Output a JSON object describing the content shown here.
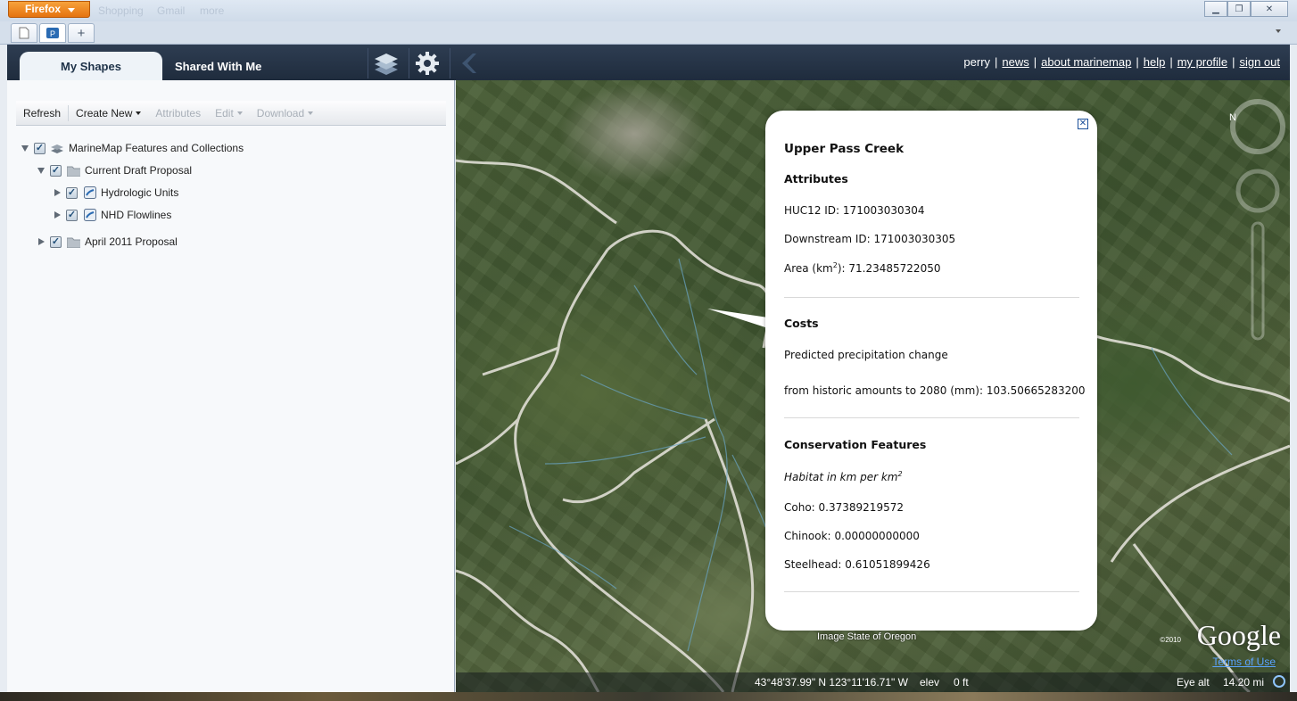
{
  "browser": {
    "app_button": "Firefox",
    "bookmarks": [
      "Shopping",
      "Gmail",
      "more"
    ],
    "new_tab_glyph": "+"
  },
  "header": {
    "tabs": [
      {
        "label": "My Shapes"
      },
      {
        "label": "Shared With Me"
      }
    ],
    "links": {
      "user": "perry",
      "news": "news",
      "about": "about marinemap",
      "help": "help",
      "profile": "my profile",
      "signout": "sign out"
    }
  },
  "toolbar": {
    "refresh": "Refresh",
    "create_new": "Create New",
    "attributes": "Attributes",
    "edit": "Edit",
    "download": "Download"
  },
  "tree": {
    "root": "MarineMap Features and Collections",
    "draft": "Current Draft Proposal",
    "hydro": "Hydrologic Units",
    "nhd": "NHD Flowlines",
    "april": "April 2011 Proposal"
  },
  "balloon": {
    "title": "Upper Pass Creek",
    "attributes_heading": "Attributes",
    "huc12_label": "HUC12 ID:",
    "huc12_value": "171003030304",
    "downstream_label": "Downstream ID:",
    "downstream_value": "171003030305",
    "area_label": "Area (km",
    "area_sup": "2",
    "area_suffix": "):",
    "area_value": "71.23485722050",
    "costs_heading": "Costs",
    "precip_line1": "Predicted precipitation change",
    "precip_line2_label": "from historic amounts to 2080 (mm):",
    "precip_value": "103.50665283200",
    "conservation_heading": "Conservation Features",
    "habitat_label": "Habitat in km per km",
    "habitat_sup": "2",
    "coho_label": "Coho:",
    "coho_value": "0.37389219572",
    "chinook_label": "Chinook:",
    "chinook_value": "0.00000000000",
    "steelhead_label": "Steelhead:",
    "steelhead_value": "0.61051899426"
  },
  "map": {
    "credit": "Image State of Oregon",
    "copyright": "©2010",
    "logo": "Google",
    "terms": "Terms of Use",
    "coords": "43°48'37.99\" N  123°11'16.71\" W",
    "elev_label": "elev",
    "elev_value": "0 ft",
    "eye_label": "Eye alt",
    "eye_value": "14.20 mi"
  },
  "colors": {
    "header_bg": "#26354a",
    "ff_orange": "#e8821e",
    "link_blue": "#1a4f9a",
    "terms_blue": "#5aa3ff"
  }
}
